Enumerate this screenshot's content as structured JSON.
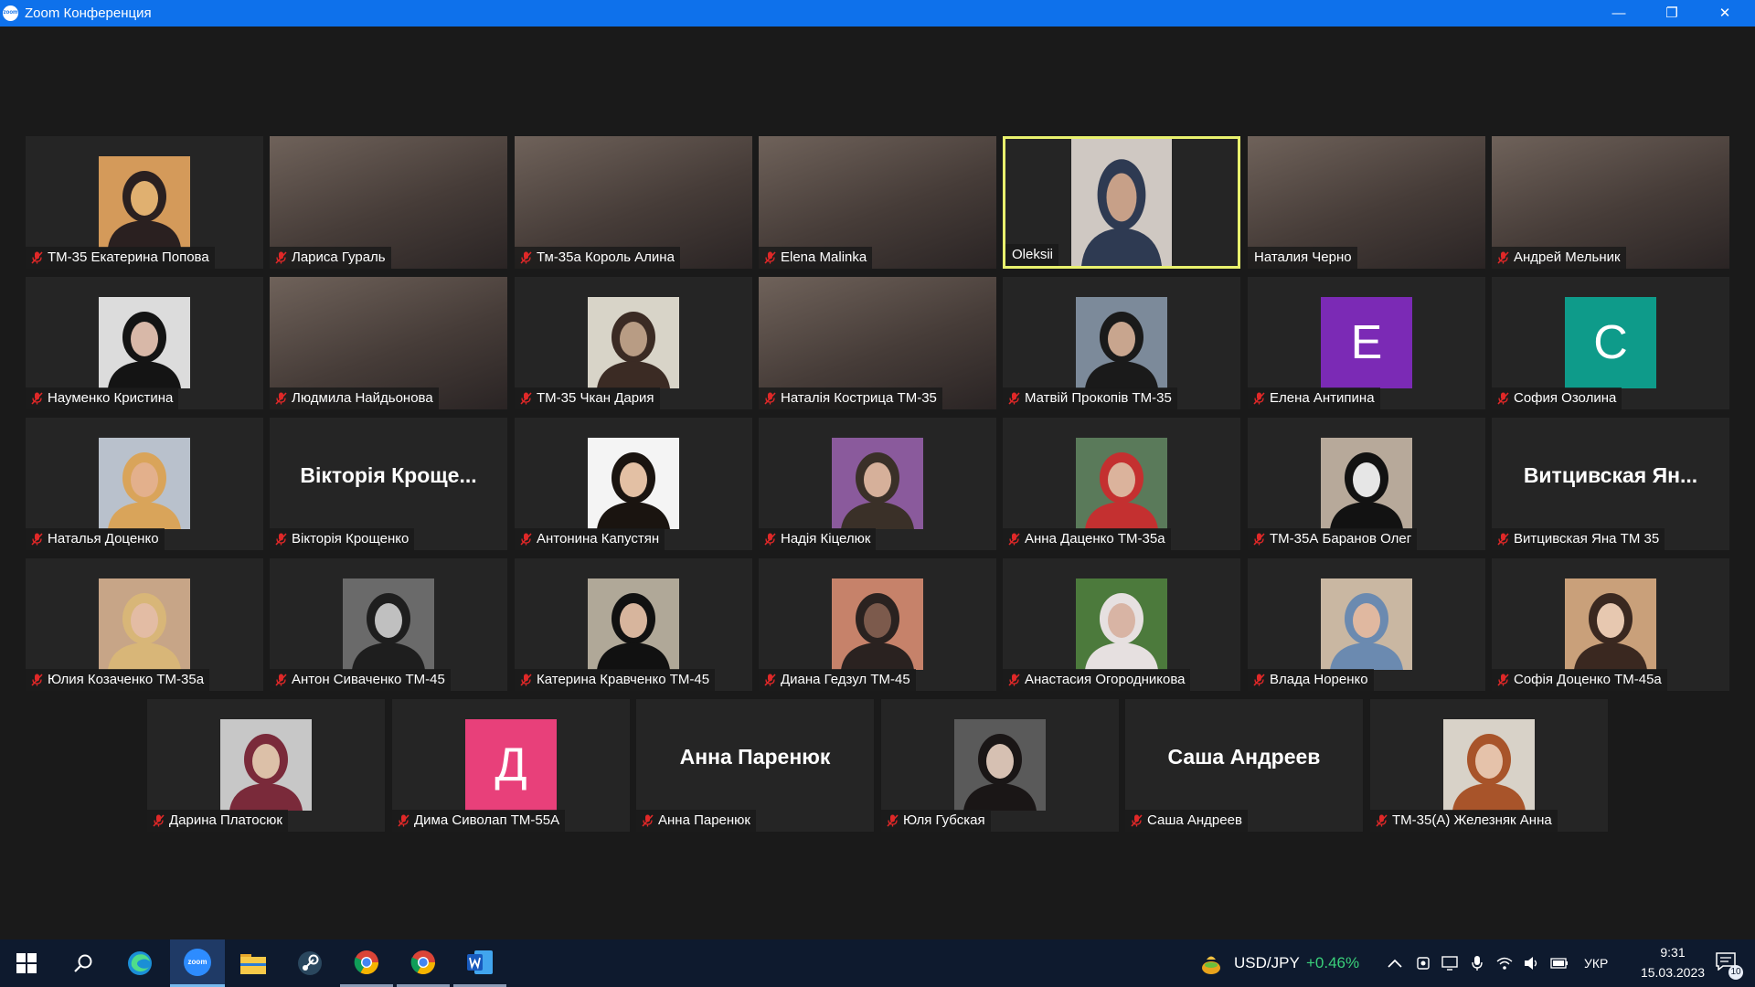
{
  "window": {
    "title": "Zoom Конференция",
    "logo_text": "zoom",
    "minimize": "—",
    "restore": "❐",
    "close": "✕"
  },
  "participants": [
    {
      "name": "ТМ-35 Екатерина Попова",
      "kind": "photo",
      "muted": true,
      "colors": [
        "#d49a5a",
        "#2a2020",
        "#e0b070"
      ]
    },
    {
      "name": "Лариса Гураль",
      "kind": "cam",
      "muted": true
    },
    {
      "name": "Тм-35а Король Алина",
      "kind": "cam",
      "muted": true
    },
    {
      "name": "Elena Malinka",
      "kind": "cam",
      "muted": true
    },
    {
      "name": "Oleksii",
      "kind": "photo",
      "muted": false,
      "active": true,
      "colors": [
        "#cfc8c2",
        "#2e3a52",
        "#c7a088"
      ]
    },
    {
      "name": "Наталия Черно",
      "kind": "cam",
      "muted": false
    },
    {
      "name": "Андрей Мельник",
      "kind": "cam",
      "muted": true
    },
    {
      "name": "Науменко Кристина",
      "kind": "photo",
      "muted": true,
      "colors": [
        "#dcdcdc",
        "#141414",
        "#d8b8a8"
      ]
    },
    {
      "name": "Людмила Найдьонова",
      "kind": "cam",
      "muted": true
    },
    {
      "name": "ТМ-35 Чкан Дария",
      "kind": "photo",
      "muted": true,
      "colors": [
        "#d8d4c8",
        "#3b2b24",
        "#b89c84"
      ]
    },
    {
      "name": "Наталія Кострица ТМ-35",
      "kind": "cam",
      "muted": true
    },
    {
      "name": "Матвій Прокопів ТМ-35",
      "kind": "photo",
      "muted": true,
      "colors": [
        "#7c8a9a",
        "#1a1a1a",
        "#c8a58e"
      ]
    },
    {
      "name": "Елена Антипина",
      "kind": "letter",
      "letter": "E",
      "bg": "#7b2ab5",
      "muted": true
    },
    {
      "name": "София Озолина",
      "kind": "letter",
      "letter": "C",
      "bg": "#0e9b8a",
      "muted": true
    },
    {
      "name": "Наталья Доценко",
      "kind": "photo",
      "muted": true,
      "colors": [
        "#b9c1cc",
        "#d9a45a",
        "#e3b08c"
      ]
    },
    {
      "name": "Вікторія Крощенко",
      "kind": "name",
      "big": "Вікторія Кроще...",
      "muted": true
    },
    {
      "name": "Антонина Капустян",
      "kind": "photo",
      "muted": true,
      "colors": [
        "#f4f4f4",
        "#1a1410",
        "#e3c0a4"
      ]
    },
    {
      "name": "Надія Кіцелюк",
      "kind": "photo",
      "muted": true,
      "colors": [
        "#8a5a9c",
        "#3a3028",
        "#d6b09a"
      ]
    },
    {
      "name": "Анна Даценко ТМ-35а",
      "kind": "photo",
      "muted": true,
      "colors": [
        "#5a7a5a",
        "#c43030",
        "#dbb39c"
      ]
    },
    {
      "name": "ТМ-35А Баранов Олег",
      "kind": "photo",
      "muted": true,
      "colors": [
        "#b7a99a",
        "#121212",
        "#e6e6e6"
      ]
    },
    {
      "name": "Витцивская Яна ТМ 35",
      "kind": "name",
      "big": "Витцивская Ян...",
      "muted": true
    },
    {
      "name": "Юлия Козаченко ТМ-35а",
      "kind": "photo",
      "muted": true,
      "colors": [
        "#c7a587",
        "#d8b678",
        "#e3bca4"
      ]
    },
    {
      "name": "Антон Сиваченко ТМ-45",
      "kind": "photo",
      "muted": true,
      "colors": [
        "#6a6a6a",
        "#1e1e1e",
        "#c0c0c0"
      ]
    },
    {
      "name": "Катерина Кравченко ТМ-45",
      "kind": "photo",
      "muted": true,
      "colors": [
        "#b0a898",
        "#111111",
        "#d7b59d"
      ]
    },
    {
      "name": "Диана Гедзул ТМ-45",
      "kind": "photo",
      "muted": true,
      "colors": [
        "#c6826a",
        "#2a2220",
        "#7c5a4c"
      ]
    },
    {
      "name": "Анастасия Огородникова",
      "kind": "photo",
      "muted": true,
      "colors": [
        "#4c7a3c",
        "#e6e0e0",
        "#d8b4a4"
      ]
    },
    {
      "name": "Влада Норенко",
      "kind": "photo",
      "muted": true,
      "colors": [
        "#c9b7a2",
        "#6b8ab0",
        "#e0b8a0"
      ]
    },
    {
      "name": "Софія Доценко ТМ-45а",
      "kind": "photo",
      "muted": true,
      "colors": [
        "#c9a07a",
        "#3a2820",
        "#e7c8b0"
      ]
    },
    {
      "name": "Дарина Платосюк",
      "kind": "photo",
      "muted": true,
      "colors": [
        "#c7c7c7",
        "#7a2a3a",
        "#dcc0a8"
      ]
    },
    {
      "name": "Дима Сиволап ТМ-55А",
      "kind": "letter",
      "letter": "Д",
      "bg": "#e8407a",
      "muted": true
    },
    {
      "name": "Анна Паренюк",
      "kind": "name",
      "big": "Анна Паренюк",
      "muted": true
    },
    {
      "name": "Юля Губская",
      "kind": "photo",
      "muted": true,
      "colors": [
        "#5a5a5a",
        "#1a1616",
        "#d6c0b2"
      ]
    },
    {
      "name": "Саша Андреев",
      "kind": "name",
      "big": "Саша Андреев",
      "muted": true
    },
    {
      "name": "ТМ-35(А) Железняк Анна",
      "kind": "photo",
      "muted": true,
      "colors": [
        "#d8d2c8",
        "#a8542a",
        "#e5c2aa"
      ]
    }
  ],
  "taskbar": {
    "currency_pair": "USD/JPY",
    "currency_change": "+0.46%",
    "language": "УКР",
    "time": "9:31",
    "date": "15.03.2023",
    "notification_count": "10",
    "zoom_label": "zoom"
  },
  "colors": {
    "titlebar": "#0e71eb",
    "active_speaker_border": "#e9f16e",
    "muted_icon": "#e02828",
    "currency_up": "#3ad07a"
  }
}
